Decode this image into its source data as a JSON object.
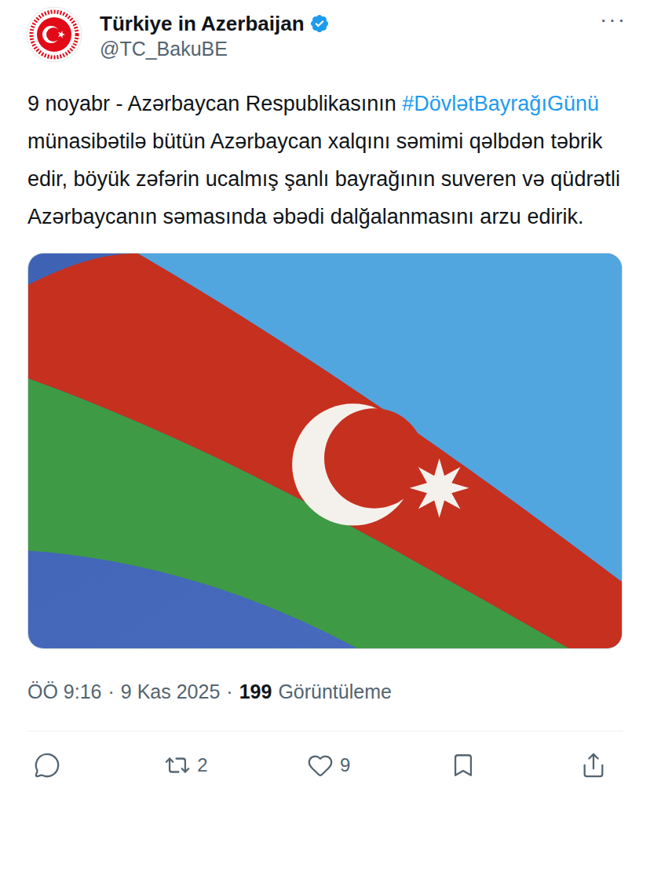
{
  "account": {
    "name": "Türkiye in Azerbaijan",
    "handle": "@TC_BakuBE",
    "verified": true
  },
  "more": "···",
  "post": {
    "segments": [
      {
        "text": "9 noyabr - Azərbaycan Respublikasının ",
        "kind": "plain"
      },
      {
        "text": "#DövlətBayrağıGünü",
        "kind": "hashtag"
      },
      {
        "text": " münasibətilə bütün Azərbaycan xalqını səmimi qəlbdən təbrik edir, böyük zəfərin ucalmış şanlı bayrağının suveren və qüdrətli Azərbaycanın səmasında əbədi dalğalanmasını arzu edirik.",
        "kind": "plain"
      }
    ]
  },
  "meta": {
    "time": "ÖÖ 9:16",
    "separator": "·",
    "date": "9 Kas 2025",
    "views": "199",
    "views_label": "Görüntüleme"
  },
  "actions": [
    {
      "kind": "reply"
    },
    {
      "kind": "retweet",
      "count": "2"
    },
    {
      "kind": "like",
      "count": "9"
    },
    {
      "kind": "bookmark"
    },
    {
      "kind": "share"
    }
  ]
}
